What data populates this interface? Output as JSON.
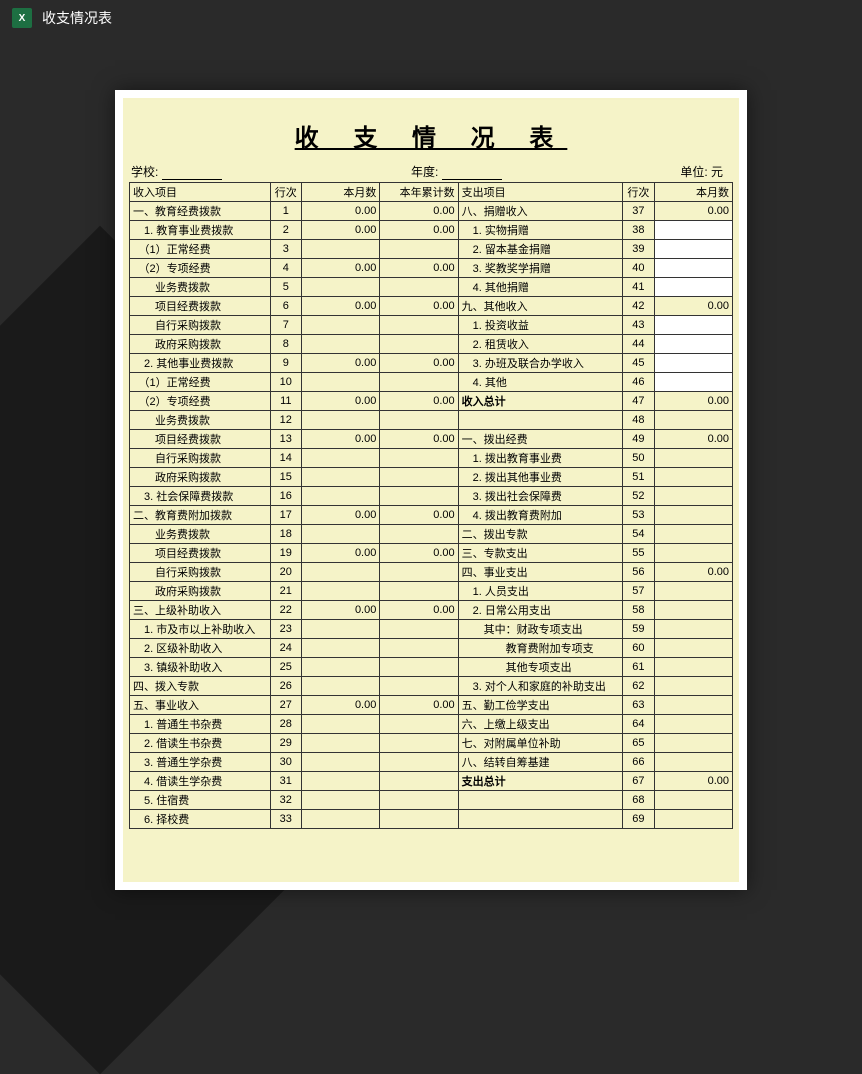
{
  "header": {
    "title": "收支情况表"
  },
  "document": {
    "title": "收 支 情 况 表",
    "school_label": "学校:",
    "year_label": "年度:",
    "unit_label": "单位: 元",
    "columns": {
      "income_item": "收入项目",
      "row": "行次",
      "month_num": "本月数",
      "ytd_num": "本年累计数",
      "expense_item": "支出项目",
      "row2": "行次",
      "month_num2": "本月数"
    },
    "rows": [
      {
        "in": "一、教育经费拨款",
        "r1": "1",
        "m1": "0.00",
        "y1": "0.00",
        "ex": "八、捐赠收入",
        "r2": "37",
        "m2": "0.00"
      },
      {
        "in": "　1. 教育事业费拨款",
        "r1": "2",
        "m1": "0.00",
        "y1": "0.00",
        "ex": "　1. 实物捐赠",
        "r2": "38",
        "m2": "",
        "white": true
      },
      {
        "in": "　（1）正常经费",
        "r1": "3",
        "m1": "",
        "y1": "",
        "ex": "　2. 留本基金捐赠",
        "r2": "39",
        "m2": "",
        "white": true
      },
      {
        "in": "　（2）专项经费",
        "r1": "4",
        "m1": "0.00",
        "y1": "0.00",
        "ex": "　3. 奖教奖学捐赠",
        "r2": "40",
        "m2": "",
        "white": true
      },
      {
        "in": "　　业务费拨款",
        "r1": "5",
        "m1": "",
        "y1": "",
        "ex": "　4. 其他捐赠",
        "r2": "41",
        "m2": "",
        "white": true
      },
      {
        "in": "　　项目经费拨款",
        "r1": "6",
        "m1": "0.00",
        "y1": "0.00",
        "ex": "九、其他收入",
        "r2": "42",
        "m2": "0.00"
      },
      {
        "in": "　　自行采购拨款",
        "r1": "7",
        "m1": "",
        "y1": "",
        "ex": "　1. 投资收益",
        "r2": "43",
        "m2": "",
        "white": true
      },
      {
        "in": "　　政府采购拨款",
        "r1": "8",
        "m1": "",
        "y1": "",
        "ex": "　2. 租赁收入",
        "r2": "44",
        "m2": "",
        "white": true
      },
      {
        "in": "　2. 其他事业费拨款",
        "r1": "9",
        "m1": "0.00",
        "y1": "0.00",
        "ex": "　3. 办班及联合办学收入",
        "r2": "45",
        "m2": "",
        "white": true
      },
      {
        "in": "　（1）正常经费",
        "r1": "10",
        "m1": "",
        "y1": "",
        "ex": "　4. 其他",
        "r2": "46",
        "m2": "",
        "white": true
      },
      {
        "in": "　（2）专项经费",
        "r1": "11",
        "m1": "0.00",
        "y1": "0.00",
        "ex": "收入总计",
        "r2": "47",
        "m2": "0.00",
        "bold": true
      },
      {
        "in": "　　业务费拨款",
        "r1": "12",
        "m1": "",
        "y1": "",
        "ex": "",
        "r2": "48",
        "m2": ""
      },
      {
        "in": "　　项目经费拨款",
        "r1": "13",
        "m1": "0.00",
        "y1": "0.00",
        "ex": "一、拨出经费",
        "r2": "49",
        "m2": "0.00"
      },
      {
        "in": "　　自行采购拨款",
        "r1": "14",
        "m1": "",
        "y1": "",
        "ex": "　1. 拨出教育事业费",
        "r2": "50",
        "m2": ""
      },
      {
        "in": "　　政府采购拨款",
        "r1": "15",
        "m1": "",
        "y1": "",
        "ex": "　2. 拨出其他事业费",
        "r2": "51",
        "m2": ""
      },
      {
        "in": "　3. 社会保障费拨款",
        "r1": "16",
        "m1": "",
        "y1": "",
        "ex": "　3. 拨出社会保障费",
        "r2": "52",
        "m2": ""
      },
      {
        "in": "二、教育费附加拨款",
        "r1": "17",
        "m1": "0.00",
        "y1": "0.00",
        "ex": "　4. 拨出教育费附加",
        "r2": "53",
        "m2": ""
      },
      {
        "in": "　　业务费拨款",
        "r1": "18",
        "m1": "",
        "y1": "",
        "ex": "二、拨出专款",
        "r2": "54",
        "m2": ""
      },
      {
        "in": "　　项目经费拨款",
        "r1": "19",
        "m1": "0.00",
        "y1": "0.00",
        "ex": "三、专款支出",
        "r2": "55",
        "m2": ""
      },
      {
        "in": "　　自行采购拨款",
        "r1": "20",
        "m1": "",
        "y1": "",
        "ex": "四、事业支出",
        "r2": "56",
        "m2": "0.00"
      },
      {
        "in": "　　政府采购拨款",
        "r1": "21",
        "m1": "",
        "y1": "",
        "ex": "　1. 人员支出",
        "r2": "57",
        "m2": ""
      },
      {
        "in": "三、上级补助收入",
        "r1": "22",
        "m1": "0.00",
        "y1": "0.00",
        "ex": "　2. 日常公用支出",
        "r2": "58",
        "m2": ""
      },
      {
        "in": "　1. 市及市以上补助收入",
        "r1": "23",
        "m1": "",
        "y1": "",
        "ex": "　　其中：财政专项支出",
        "r2": "59",
        "m2": ""
      },
      {
        "in": "　2. 区级补助收入",
        "r1": "24",
        "m1": "",
        "y1": "",
        "ex": "　　　　教育费附加专项支",
        "r2": "60",
        "m2": ""
      },
      {
        "in": "　3. 镇级补助收入",
        "r1": "25",
        "m1": "",
        "y1": "",
        "ex": "　　　　其他专项支出",
        "r2": "61",
        "m2": ""
      },
      {
        "in": "四、拨入专款",
        "r1": "26",
        "m1": "",
        "y1": "",
        "ex": "　3. 对个人和家庭的补助支出",
        "r2": "62",
        "m2": ""
      },
      {
        "in": "五、事业收入",
        "r1": "27",
        "m1": "0.00",
        "y1": "0.00",
        "ex": "五、勤工俭学支出",
        "r2": "63",
        "m2": ""
      },
      {
        "in": "　1. 普通生书杂费",
        "r1": "28",
        "m1": "",
        "y1": "",
        "ex": "六、上缴上级支出",
        "r2": "64",
        "m2": ""
      },
      {
        "in": "　2. 借读生书杂费",
        "r1": "29",
        "m1": "",
        "y1": "",
        "ex": "七、对附属单位补助",
        "r2": "65",
        "m2": ""
      },
      {
        "in": "　3. 普通生学杂费",
        "r1": "30",
        "m1": "",
        "y1": "",
        "ex": "八、结转自筹基建",
        "r2": "66",
        "m2": ""
      },
      {
        "in": "　4. 借读生学杂费",
        "r1": "31",
        "m1": "",
        "y1": "",
        "ex": "支出总计",
        "r2": "67",
        "m2": "0.00",
        "bold": true
      },
      {
        "in": "　5. 住宿费",
        "r1": "32",
        "m1": "",
        "y1": "",
        "ex": "",
        "r2": "68",
        "m2": ""
      },
      {
        "in": "　6. 择校费",
        "r1": "33",
        "m1": "",
        "y1": "",
        "ex": "",
        "r2": "69",
        "m2": ""
      }
    ]
  }
}
